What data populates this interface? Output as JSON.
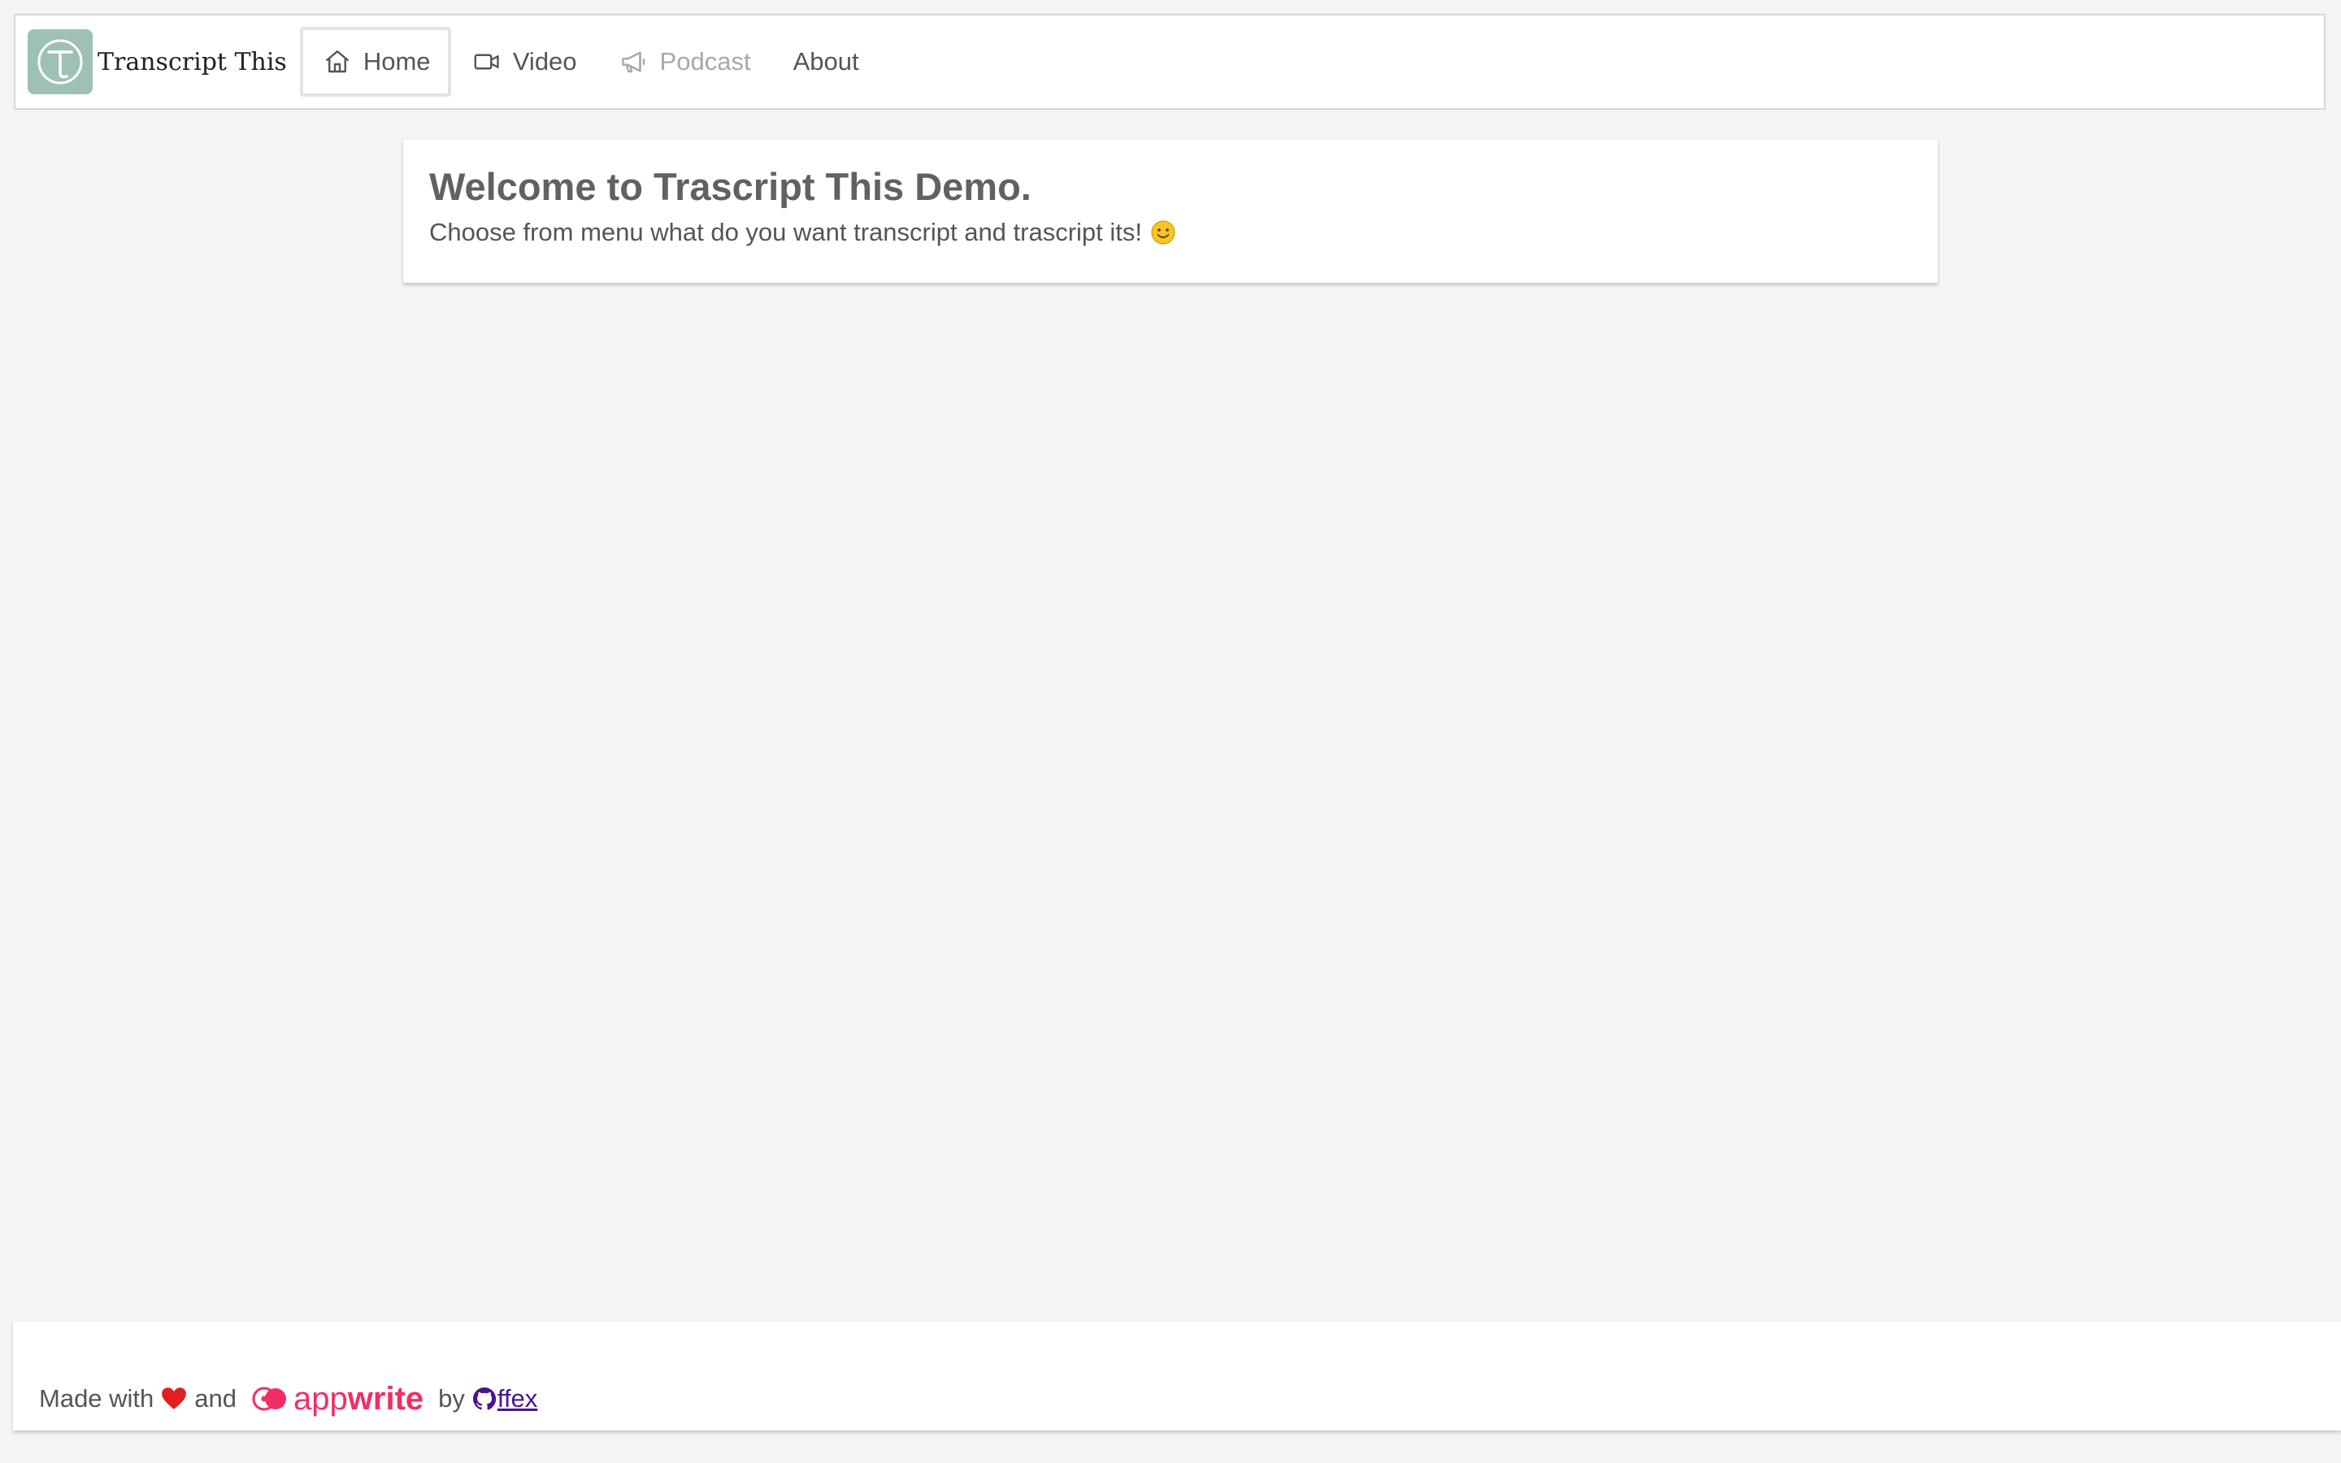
{
  "brand": {
    "name": "Transcript This",
    "logo_color": "#9fc1b4"
  },
  "nav": {
    "items": [
      {
        "label": "Home",
        "icon": "home-icon",
        "state": "active"
      },
      {
        "label": "Video",
        "icon": "video-camera-icon",
        "state": "normal"
      },
      {
        "label": "Podcast",
        "icon": "megaphone-icon",
        "state": "disabled"
      },
      {
        "label": "About",
        "icon": "",
        "state": "normal"
      }
    ]
  },
  "welcome": {
    "title": "Welcome to Trascript This Demo.",
    "message": "Choose from menu what do you want transcript and trascript its!",
    "emoji_icon": "smiley-icon"
  },
  "footer": {
    "made_with": "Made with",
    "heart_icon": "heart-icon",
    "and": "and",
    "appwrite_light": "app",
    "appwrite_bold": "write",
    "by": "by",
    "author": "ffex",
    "author_icon": "github-icon",
    "appwrite_color": "#f02e65",
    "author_link_color": "#4a148c"
  }
}
